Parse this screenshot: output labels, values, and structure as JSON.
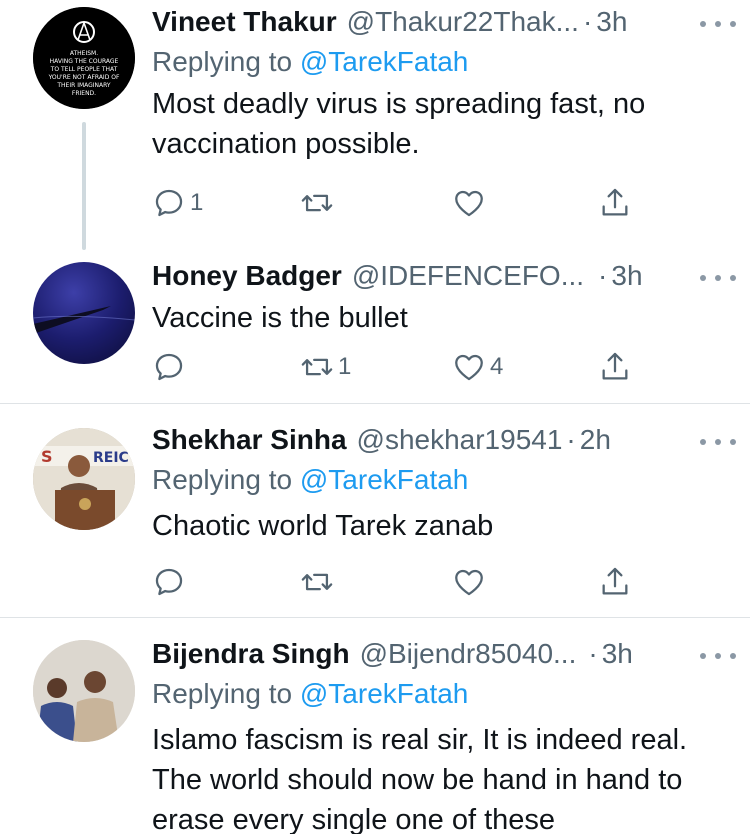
{
  "tweets": [
    {
      "name": "Vineet Thakur",
      "handle": "@Thakur22Thak...",
      "time": "3h",
      "reply_prefix": "Replying to ",
      "reply_to": "@TarekFatah",
      "text": "Most deadly virus is spreading fast, no vaccination possible.",
      "reply_count": "1",
      "retweet_count": "",
      "like_count": "",
      "avatar_text": "ATHEISM. HAVING THE COURAGE TO TELL PEOPLE THAT YOU'RE NOT AFRAID OF THEIR IMAGINARY FRIEND."
    },
    {
      "name": "Honey Badger",
      "handle": "@IDEFENCEFO...",
      "time": "3h",
      "text": "Vaccine is the bullet",
      "reply_count": "",
      "retweet_count": "1",
      "like_count": "4"
    },
    {
      "name": "Shekhar Sinha",
      "handle": "@shekhar19541",
      "time": "2h",
      "reply_prefix": "Replying to ",
      "reply_to": "@TarekFatah",
      "text": "Chaotic world Tarek zanab",
      "reply_count": "",
      "retweet_count": "",
      "like_count": ""
    },
    {
      "name": "Bijendra Singh",
      "handle": "@Bijendr85040...",
      "time": "3h",
      "reply_prefix": "Replying to ",
      "reply_to": "@TarekFatah",
      "text": "Islamo fascism is real sir, It is indeed real. The world should now be hand in hand to erase every single one of these"
    }
  ],
  "separator": "·",
  "icons": {
    "more": "more-horizontal-icon",
    "reply": "reply-bubble-icon",
    "retweet": "retweet-icon",
    "like": "heart-icon",
    "share": "share-upload-icon"
  },
  "colors": {
    "link": "#1d9bf0",
    "secondary_text": "#536471",
    "primary_text": "#0f1419",
    "divider": "#dfe3e6"
  }
}
